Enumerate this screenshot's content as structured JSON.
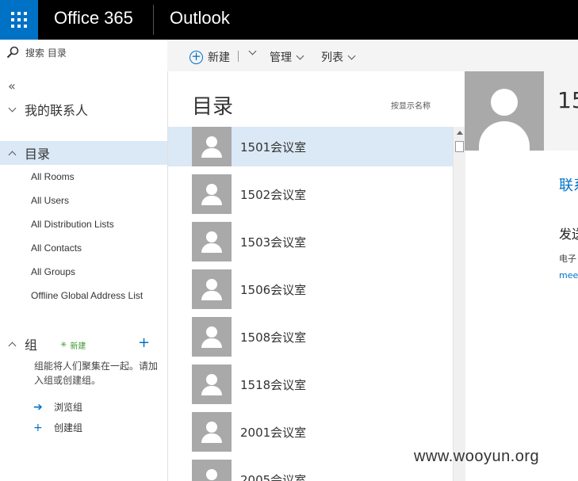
{
  "header": {
    "brand": "Office 365",
    "app": "Outlook"
  },
  "search": {
    "placeholder": "搜索 目录"
  },
  "toolbar": {
    "new_label": "新建",
    "manage_label": "管理",
    "list_label": "列表"
  },
  "nav": {
    "collapse_glyph": "«",
    "my_contacts": "我的联系人",
    "directory": "目录",
    "directory_items": [
      "All Rooms",
      "All Users",
      "All Distribution Lists",
      "All Contacts",
      "All Groups",
      "Offline Global Address List"
    ],
    "groups": {
      "title": "组",
      "new_badge": "新建",
      "description": "组能将人们聚集在一起。请加入组或创建组。",
      "browse": "浏览组",
      "create": "创建组"
    }
  },
  "list": {
    "title": "目录",
    "sort_label": "按显示名称",
    "items": [
      "1501会议室",
      "1502会议室",
      "1503会议室",
      "1506会议室",
      "1508会议室",
      "1518会议室",
      "2001会议室",
      "2005会议室"
    ]
  },
  "detail": {
    "name": "15",
    "link": "联系",
    "section": "发送",
    "label": "电子",
    "email": "mee"
  },
  "watermark": "www.wooyun.org",
  "colors": {
    "accent": "#0072c6",
    "selected": "#dbe8f5",
    "new_badge": "#3a9b2f"
  },
  "icons": {
    "app_launcher": "waffle-icon",
    "search": "search-icon",
    "new": "plus-circle-icon",
    "add_group": "plus-icon",
    "browse": "arrow-right-icon",
    "create": "plus-icon"
  }
}
